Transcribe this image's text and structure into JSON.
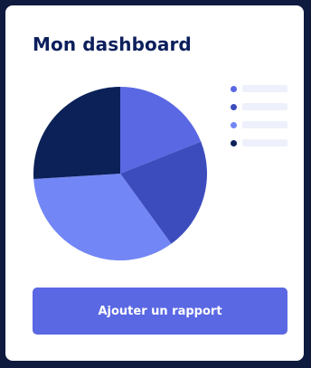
{
  "card": {
    "title": "Mon dashboard",
    "button_label": "Ajouter un rapport"
  },
  "colors": {
    "page_background": "#0f1a3f",
    "card_background": "#ffffff",
    "title": "#0c1f5c",
    "button": "#5a68e3",
    "legend_placeholder": "#eef1fb"
  },
  "chart_data": {
    "type": "pie",
    "title": "",
    "legend_position": "right",
    "slices": [
      {
        "value": 19,
        "color": "#5a68e3"
      },
      {
        "value": 21,
        "color": "#3d4cbd"
      },
      {
        "value": 34,
        "color": "#7386f5"
      },
      {
        "value": 26,
        "color": "#0b2158"
      }
    ],
    "legend_colors": [
      "#5a68e3",
      "#3d4cbd",
      "#7386f5",
      "#0b2158"
    ]
  }
}
